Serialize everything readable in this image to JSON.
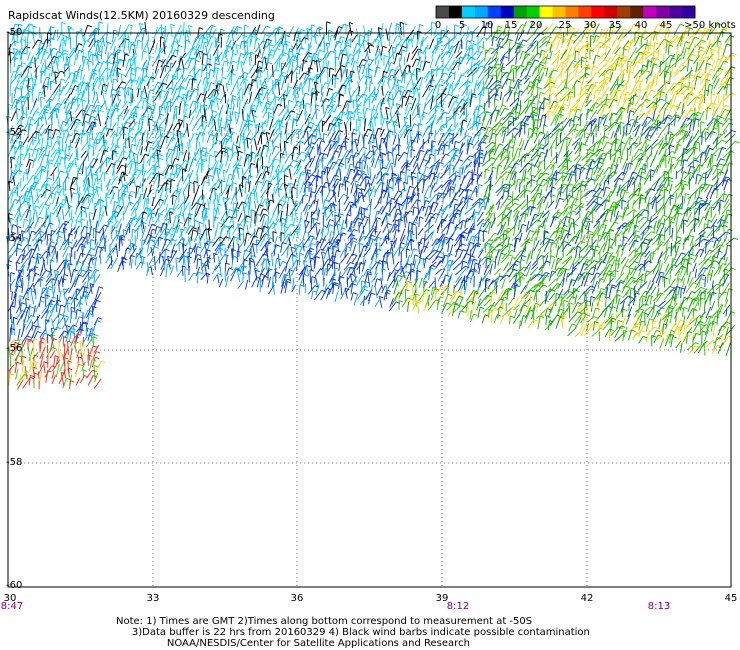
{
  "title": "Rapidscat Winds(12.5KM) 20160329 descending",
  "legend": {
    "labels": [
      "0",
      "5",
      "10",
      "15",
      "20",
      "25",
      "30",
      "35",
      "40",
      "45",
      ">50 knots"
    ],
    "colors": [
      "#4a4a4a",
      "#000000",
      "#00cfff",
      "#00a8ff",
      "#0040ff",
      "#0000c0",
      "#00a000",
      "#00d000",
      "#ffff00",
      "#ffc000",
      "#ff8000",
      "#ff4000",
      "#ff0000",
      "#d00000",
      "#a04000",
      "#602000",
      "#c000c0",
      "#8000a0",
      "#5000a0",
      "#3000a0"
    ]
  },
  "axes": {
    "lat_labels": [
      "-52",
      "-54",
      "-56",
      "-58",
      "-60"
    ],
    "top_lat_label": "-50",
    "lon_labels": [
      "30",
      "33",
      "36",
      "39",
      "42",
      "45"
    ],
    "lon_range": [
      30,
      45
    ],
    "lat_range": [
      -60,
      -50
    ],
    "time_labels": [
      "8:47",
      "8:12",
      "8:13"
    ]
  },
  "notes": {
    "line1": "Note: 1) Times are GMT 2)Times along bottom correspond to measurement at -50S",
    "line2": "3)Data buffer is 22 hrs from 20160329 4) Black wind barbs indicate possible contamination",
    "line3": "NOAA/NESDIS/Center for Satellite Applications and Research"
  },
  "wind_palette": {
    "calm": "#000000",
    "light": "#00d0ff",
    "moderate": "#00a0ff",
    "fresh": "#0030e0",
    "strong": "#00a000",
    "gale": "#30c000",
    "storm": "#ffd000",
    "severe": "#ff8000",
    "violent": "#ff2000"
  }
}
